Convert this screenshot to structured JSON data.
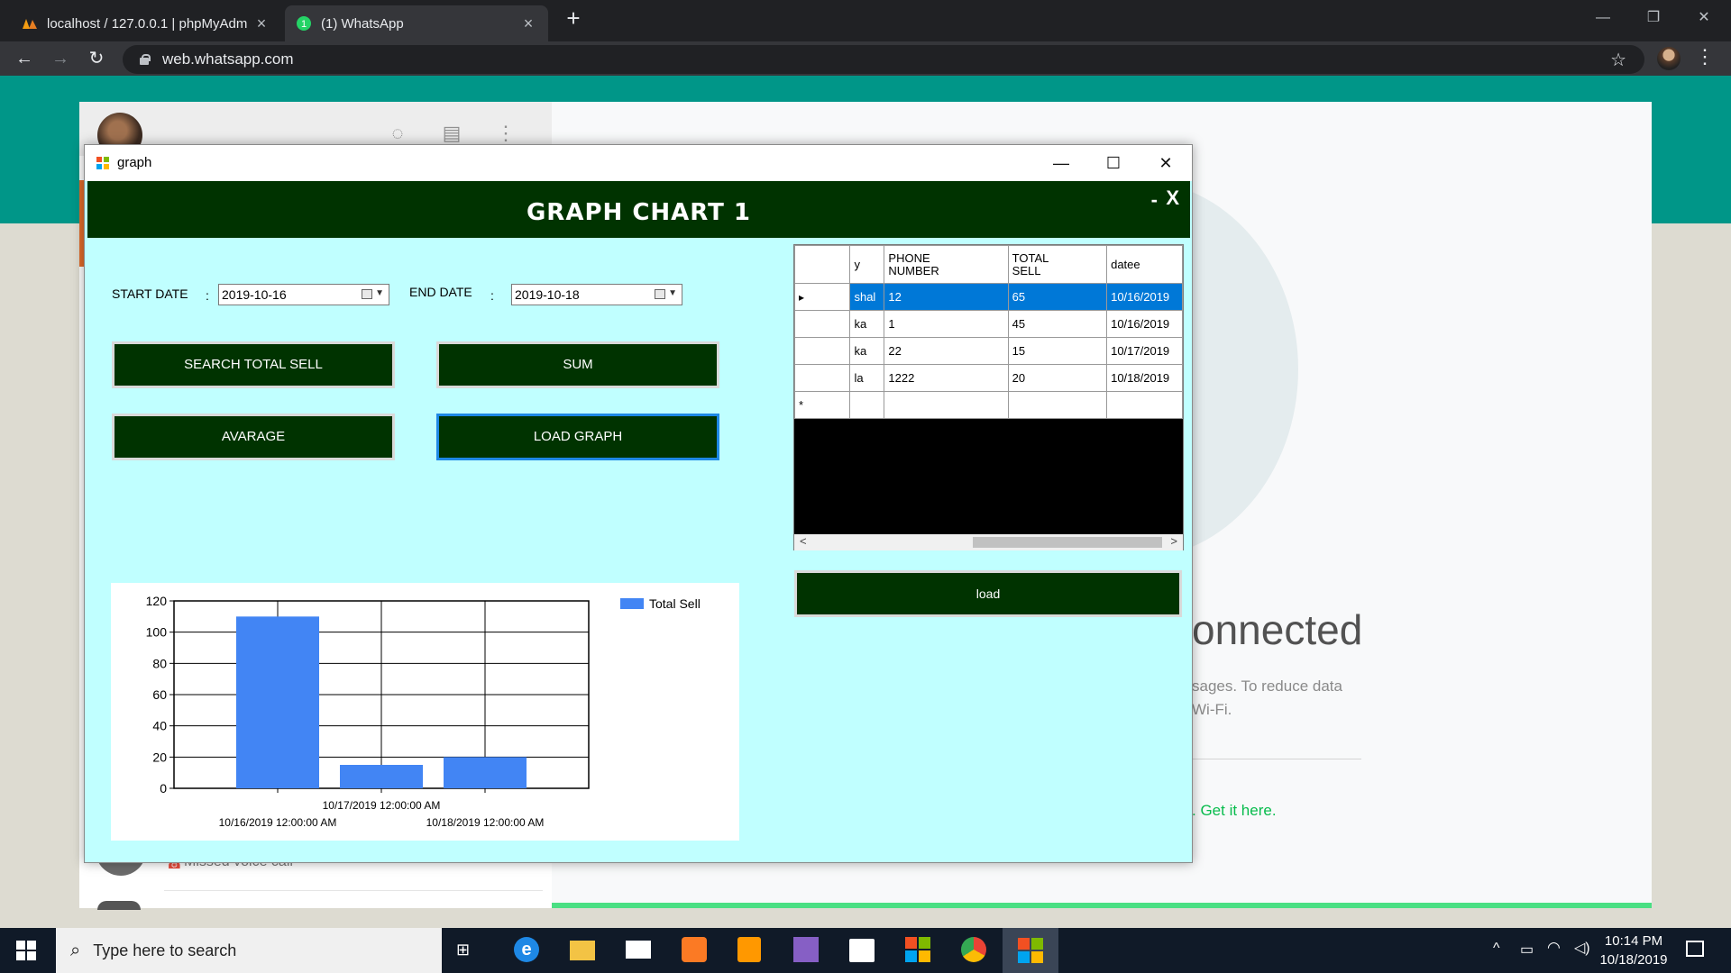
{
  "browser": {
    "tabs": [
      {
        "title": "localhost / 127.0.0.1 | phpMyAdm",
        "active": false
      },
      {
        "title": "(1) WhatsApp",
        "active": true,
        "badge": "1"
      }
    ],
    "url": "web.whatsapp.com"
  },
  "whatsapp": {
    "title": "onnected",
    "desc_line1": "sages. To reduce data",
    "desc_line2": "Wi-Fi.",
    "link": ". Get it here.",
    "missed_call": "Missed voice call"
  },
  "form": {
    "window_title": "graph",
    "header_title": "GRAPH CHART 1",
    "header_min": "-",
    "header_close": "X",
    "start_label": "START DATE",
    "start_colon": ":",
    "start_value": "2019-10-16",
    "end_label": "END DATE",
    "end_colon": ":",
    "end_value": "2019-10-18",
    "buttons": {
      "search": "SEARCH TOTAL SELL",
      "sum": "SUM",
      "average": "AVARAGE",
      "load_graph": "LOAD GRAPH",
      "load": "load"
    },
    "grid": {
      "columns": [
        "y",
        "PHONE NUMBER",
        "TOTAL SELL",
        "datee"
      ],
      "rows": [
        {
          "name": "shal",
          "phone": "12",
          "total": "65",
          "date": "10/16/2019"
        },
        {
          "name": "ka",
          "phone": "1",
          "total": "45",
          "date": "10/16/2019"
        },
        {
          "name": "ka",
          "phone": "22",
          "total": "15",
          "date": "10/17/2019"
        },
        {
          "name": "la",
          "phone": "1222",
          "total": "20",
          "date": "10/18/2019"
        }
      ],
      "new_row_marker": "*",
      "selected_row_marker": "▸"
    }
  },
  "chart_data": {
    "type": "bar",
    "categories": [
      "10/16/2019 12:00:00 AM",
      "10/17/2019 12:00:00 AM",
      "10/18/2019 12:00:00 AM"
    ],
    "series": [
      {
        "name": "Total Sell",
        "values": [
          110,
          15,
          20
        ],
        "color": "#4285f4"
      }
    ],
    "yticks": [
      0,
      20,
      40,
      60,
      80,
      100,
      120
    ],
    "ylim": [
      0,
      120
    ],
    "grid": true,
    "legend": "top-right"
  },
  "taskbar": {
    "search_placeholder": "Type here to search",
    "time": "10:14 PM",
    "date": "10/18/2019"
  },
  "colors": {
    "form_bg": "#c0ffff",
    "button_bg": "#003300",
    "bar": "#4285f4",
    "selection": "#0078d7"
  }
}
